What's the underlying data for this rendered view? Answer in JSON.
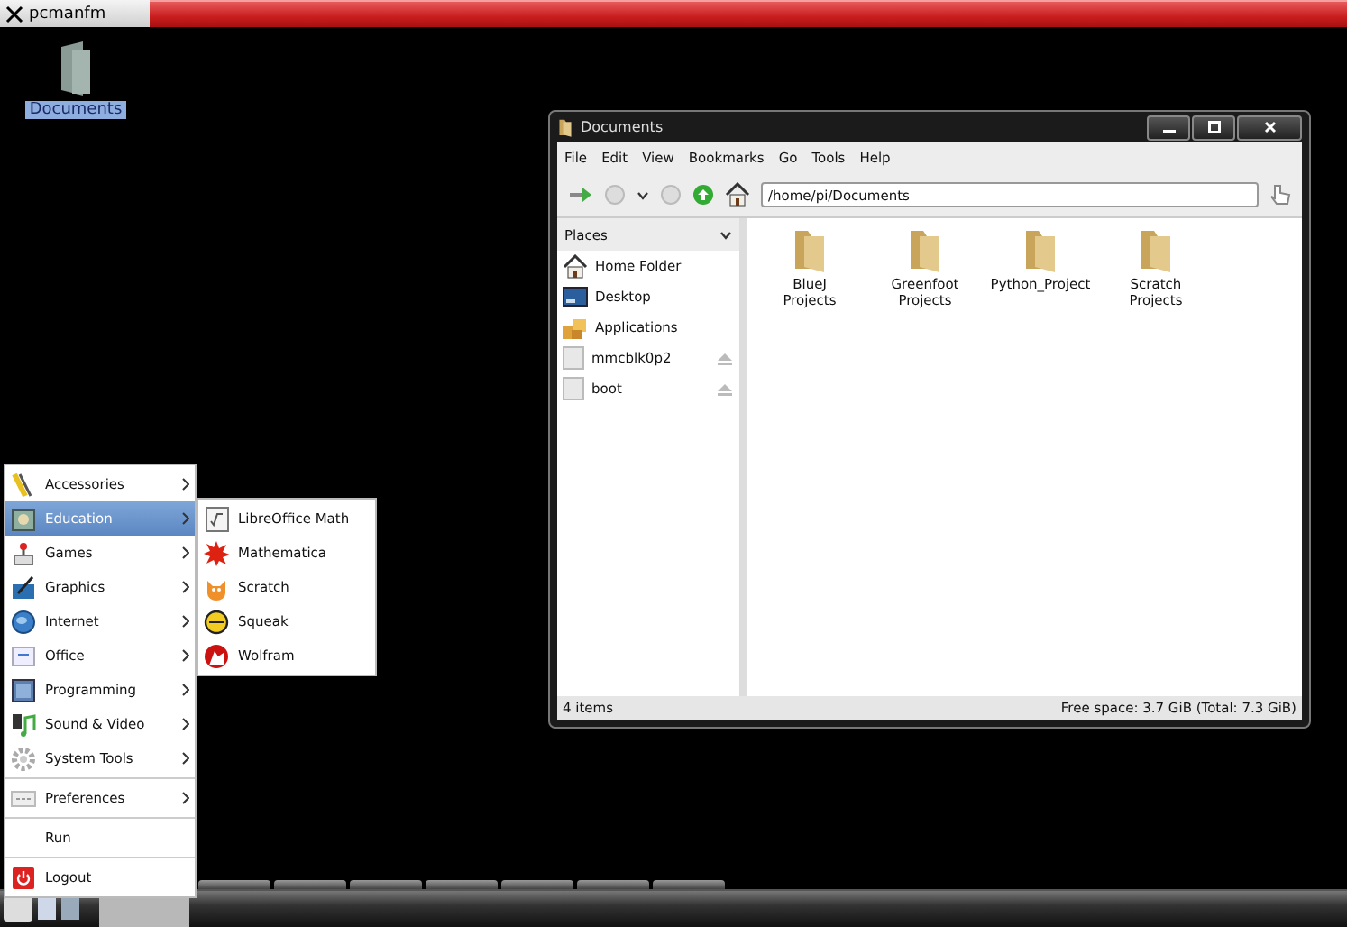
{
  "top_bar": {
    "app_title": "pcmanfm"
  },
  "desktop_icons": [
    {
      "label": "Documents",
      "selected": true
    }
  ],
  "window": {
    "title": "Documents",
    "menu": [
      "File",
      "Edit",
      "View",
      "Bookmarks",
      "Go",
      "Tools",
      "Help"
    ],
    "location": "/home/pi/Documents",
    "places_header": "Places",
    "places": [
      {
        "label": "Home Folder",
        "kind": "home"
      },
      {
        "label": "Desktop",
        "kind": "desktop"
      },
      {
        "label": "Applications",
        "kind": "apps"
      },
      {
        "label": "mmcblk0p2",
        "kind": "drive"
      },
      {
        "label": "boot",
        "kind": "drive"
      }
    ],
    "files": [
      "BlueJ Projects",
      "Greenfoot Projects",
      "Python_Project",
      "Scratch Projects"
    ],
    "status_left": "4 items",
    "status_right": "Free space: 3.7 GiB (Total: 7.3 GiB)"
  },
  "start_menu": {
    "items": [
      {
        "label": "Accessories",
        "kind": "submenu",
        "selected": false
      },
      {
        "label": "Education",
        "kind": "submenu",
        "selected": true
      },
      {
        "label": "Games",
        "kind": "submenu",
        "selected": false
      },
      {
        "label": "Graphics",
        "kind": "submenu",
        "selected": false
      },
      {
        "label": "Internet",
        "kind": "submenu",
        "selected": false
      },
      {
        "label": "Office",
        "kind": "submenu",
        "selected": false
      },
      {
        "label": "Programming",
        "kind": "submenu",
        "selected": false
      },
      {
        "label": "Sound & Video",
        "kind": "submenu",
        "selected": false
      },
      {
        "label": "System Tools",
        "kind": "submenu",
        "selected": false
      },
      {
        "label": "Preferences",
        "kind": "submenu",
        "selected": false
      },
      {
        "label": "Run",
        "kind": "plain",
        "selected": false
      },
      {
        "label": "Logout",
        "kind": "plain",
        "selected": false
      }
    ],
    "submenu": [
      "LibreOffice Math",
      "Mathematica",
      "Scratch",
      "Squeak",
      "Wolfram"
    ]
  }
}
